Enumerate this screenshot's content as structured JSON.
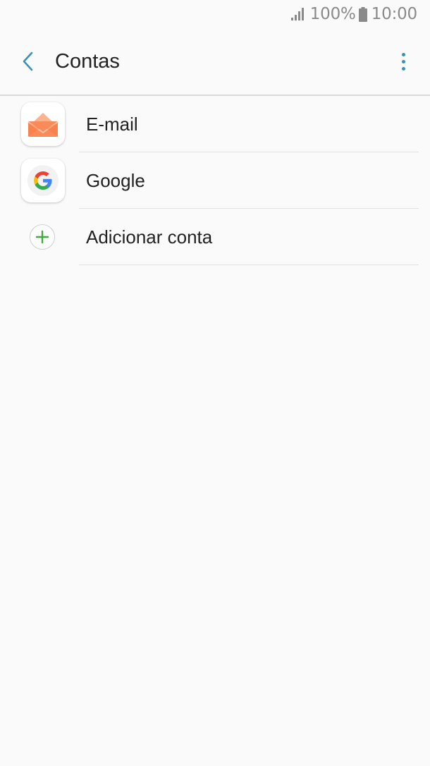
{
  "status_bar": {
    "battery_percent": "100%",
    "time": "10:00"
  },
  "app_bar": {
    "title": "Contas"
  },
  "accounts": [
    {
      "label": "E-mail",
      "icon": "email-envelope-icon"
    },
    {
      "label": "Google",
      "icon": "google-g-icon"
    },
    {
      "label": "Adicionar conta",
      "icon": "add-plus-icon"
    }
  ],
  "colors": {
    "accent": "#3a91b8",
    "add_green": "#3dae3d",
    "email_orange": "#f98b5a"
  }
}
